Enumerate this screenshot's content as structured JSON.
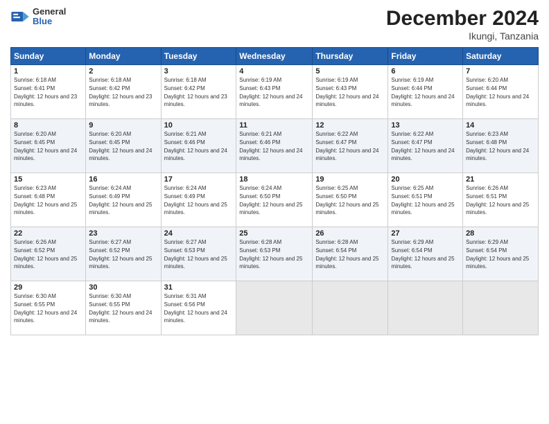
{
  "logo": {
    "general": "General",
    "blue": "Blue"
  },
  "header": {
    "month": "December 2024",
    "location": "Ikungi, Tanzania"
  },
  "days_of_week": [
    "Sunday",
    "Monday",
    "Tuesday",
    "Wednesday",
    "Thursday",
    "Friday",
    "Saturday"
  ],
  "weeks": [
    [
      {
        "day": "1",
        "sunrise": "6:18 AM",
        "sunset": "6:41 PM",
        "daylight": "12 hours and 23 minutes."
      },
      {
        "day": "2",
        "sunrise": "6:18 AM",
        "sunset": "6:42 PM",
        "daylight": "12 hours and 23 minutes."
      },
      {
        "day": "3",
        "sunrise": "6:18 AM",
        "sunset": "6:42 PM",
        "daylight": "12 hours and 23 minutes."
      },
      {
        "day": "4",
        "sunrise": "6:19 AM",
        "sunset": "6:43 PM",
        "daylight": "12 hours and 24 minutes."
      },
      {
        "day": "5",
        "sunrise": "6:19 AM",
        "sunset": "6:43 PM",
        "daylight": "12 hours and 24 minutes."
      },
      {
        "day": "6",
        "sunrise": "6:19 AM",
        "sunset": "6:44 PM",
        "daylight": "12 hours and 24 minutes."
      },
      {
        "day": "7",
        "sunrise": "6:20 AM",
        "sunset": "6:44 PM",
        "daylight": "12 hours and 24 minutes."
      }
    ],
    [
      {
        "day": "8",
        "sunrise": "6:20 AM",
        "sunset": "6:45 PM",
        "daylight": "12 hours and 24 minutes."
      },
      {
        "day": "9",
        "sunrise": "6:20 AM",
        "sunset": "6:45 PM",
        "daylight": "12 hours and 24 minutes."
      },
      {
        "day": "10",
        "sunrise": "6:21 AM",
        "sunset": "6:46 PM",
        "daylight": "12 hours and 24 minutes."
      },
      {
        "day": "11",
        "sunrise": "6:21 AM",
        "sunset": "6:46 PM",
        "daylight": "12 hours and 24 minutes."
      },
      {
        "day": "12",
        "sunrise": "6:22 AM",
        "sunset": "6:47 PM",
        "daylight": "12 hours and 24 minutes."
      },
      {
        "day": "13",
        "sunrise": "6:22 AM",
        "sunset": "6:47 PM",
        "daylight": "12 hours and 24 minutes."
      },
      {
        "day": "14",
        "sunrise": "6:23 AM",
        "sunset": "6:48 PM",
        "daylight": "12 hours and 24 minutes."
      }
    ],
    [
      {
        "day": "15",
        "sunrise": "6:23 AM",
        "sunset": "6:48 PM",
        "daylight": "12 hours and 25 minutes."
      },
      {
        "day": "16",
        "sunrise": "6:24 AM",
        "sunset": "6:49 PM",
        "daylight": "12 hours and 25 minutes."
      },
      {
        "day": "17",
        "sunrise": "6:24 AM",
        "sunset": "6:49 PM",
        "daylight": "12 hours and 25 minutes."
      },
      {
        "day": "18",
        "sunrise": "6:24 AM",
        "sunset": "6:50 PM",
        "daylight": "12 hours and 25 minutes."
      },
      {
        "day": "19",
        "sunrise": "6:25 AM",
        "sunset": "6:50 PM",
        "daylight": "12 hours and 25 minutes."
      },
      {
        "day": "20",
        "sunrise": "6:25 AM",
        "sunset": "6:51 PM",
        "daylight": "12 hours and 25 minutes."
      },
      {
        "day": "21",
        "sunrise": "6:26 AM",
        "sunset": "6:51 PM",
        "daylight": "12 hours and 25 minutes."
      }
    ],
    [
      {
        "day": "22",
        "sunrise": "6:26 AM",
        "sunset": "6:52 PM",
        "daylight": "12 hours and 25 minutes."
      },
      {
        "day": "23",
        "sunrise": "6:27 AM",
        "sunset": "6:52 PM",
        "daylight": "12 hours and 25 minutes."
      },
      {
        "day": "24",
        "sunrise": "6:27 AM",
        "sunset": "6:53 PM",
        "daylight": "12 hours and 25 minutes."
      },
      {
        "day": "25",
        "sunrise": "6:28 AM",
        "sunset": "6:53 PM",
        "daylight": "12 hours and 25 minutes."
      },
      {
        "day": "26",
        "sunrise": "6:28 AM",
        "sunset": "6:54 PM",
        "daylight": "12 hours and 25 minutes."
      },
      {
        "day": "27",
        "sunrise": "6:29 AM",
        "sunset": "6:54 PM",
        "daylight": "12 hours and 25 minutes."
      },
      {
        "day": "28",
        "sunrise": "6:29 AM",
        "sunset": "6:54 PM",
        "daylight": "12 hours and 25 minutes."
      }
    ],
    [
      {
        "day": "29",
        "sunrise": "6:30 AM",
        "sunset": "6:55 PM",
        "daylight": "12 hours and 24 minutes."
      },
      {
        "day": "30",
        "sunrise": "6:30 AM",
        "sunset": "6:55 PM",
        "daylight": "12 hours and 24 minutes."
      },
      {
        "day": "31",
        "sunrise": "6:31 AM",
        "sunset": "6:56 PM",
        "daylight": "12 hours and 24 minutes."
      },
      null,
      null,
      null,
      null
    ]
  ]
}
